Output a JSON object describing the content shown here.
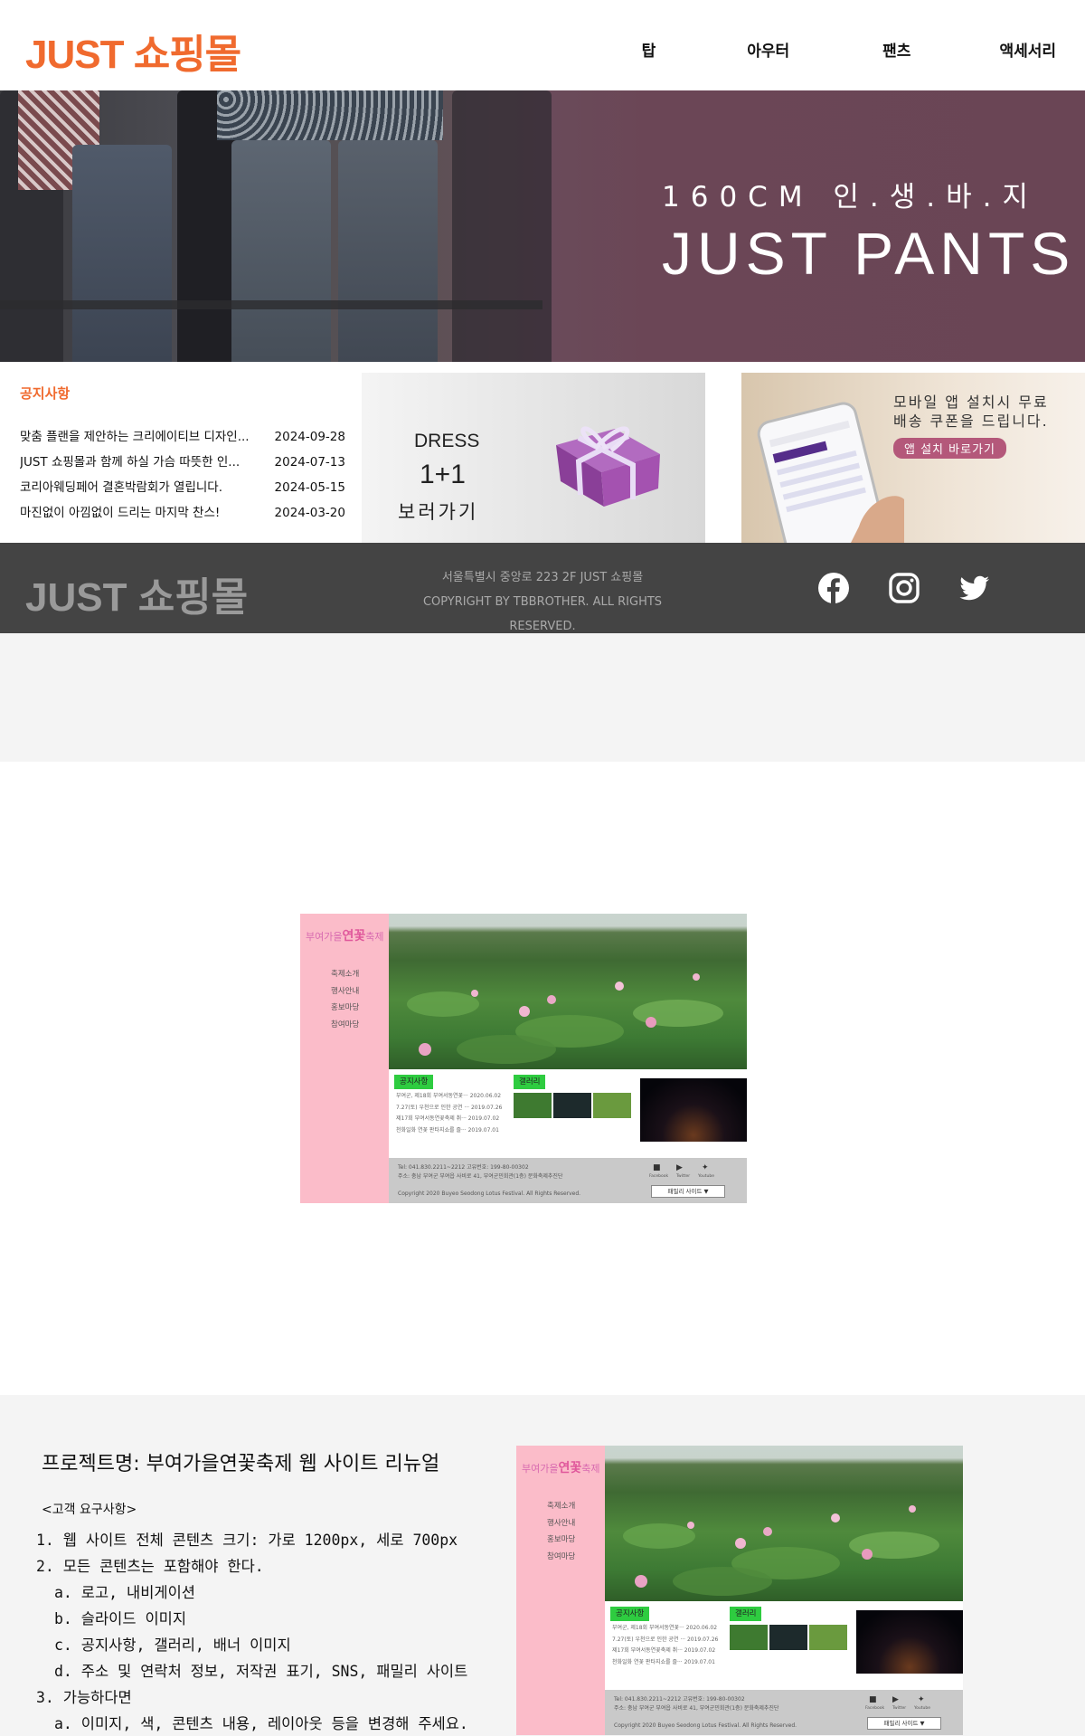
{
  "shop": {
    "logo": "JUST 쇼핑몰",
    "nav": [
      "탑",
      "아우터",
      "팬츠",
      "액세서리"
    ],
    "banner": {
      "subtitle": "160CM 인.생.바.지",
      "title": "JUST PANTS"
    },
    "notice": {
      "heading": "공지사항",
      "items": [
        {
          "title": "맞춤 플랜을 제안하는 크리에이티브 디자인...",
          "date": "2024-09-28"
        },
        {
          "title": "JUST 쇼핑몰과 함께 하실 가슴 따뜻한 인...",
          "date": "2024-07-13"
        },
        {
          "title": "코리아웨딩페어 결혼박람회가 열립니다.",
          "date": "2024-05-15"
        },
        {
          "title": "마진없이 아낌없이 드리는 마지막 찬스!",
          "date": "2024-03-20"
        }
      ]
    },
    "gift_banner": {
      "line1": "DRESS",
      "line2": "1+1",
      "line3": "보러가기"
    },
    "app_banner": {
      "line1": "모바일 앱 설치시 무료",
      "line2": "배송 쿠폰을 드립니다.",
      "button": "앱 설치 바로가기"
    },
    "footer": {
      "logo": "JUST 쇼핑몰",
      "address": "서울특별시 중앙로 223 2F JUST 쇼핑몰",
      "copyright": "COPYRIGHT BY TBBROTHER. ALL RIGHTS RESERVED.",
      "sns": [
        "facebook-icon",
        "instagram-icon",
        "twitter-icon"
      ]
    }
  },
  "thumbnail": {
    "logo_pre": "부여가을",
    "logo_main": "연꽃",
    "logo_post": "축제",
    "menu": [
      "축제소개",
      "행사안내",
      "홍보마당",
      "참여마당"
    ],
    "tab_notice": "공지사항",
    "tab_gallery": "갤러리",
    "notices": [
      "부여군, 제18회 부여서동연꽃··· 2020.06.02",
      "7.27(토) 우천으로 인한 공연 ··· 2019.07.26",
      "제17회 부여서동연꽃축제 취··· 2019.07.02",
      "천화일화 연꽃 판타지쇼를 즐··· 2019.07.01"
    ],
    "address": "Tel: 041.830.2211~2212 고유번호: 199-80-00302",
    "address2": "주소: 충남 부여군 부여읍 사비로 41, 부여군민회관(1층) 문화축제추진단",
    "copyright": "Copyright 2020 Buyeo Seodong Lotus Festival. All Rights Reserved.",
    "family_site": "패밀리 사이트 ▼",
    "sns_labels": [
      "Facebook",
      "Twitter",
      "Youtube"
    ]
  },
  "project": {
    "title": "프로젝트명: 부여가을연꽃축제 웹 사이트 리뉴얼",
    "req_heading": "<고객 요구사항>",
    "requirements": [
      "1. 웹 사이트 전체 콘텐츠 크기: 가로 1200px, 세로 700px",
      "2. 모든 콘텐츠는 포함해야 한다.",
      "a. 로고, 내비게이션",
      "b. 슬라이드 이미지",
      "c. 공지사항, 갤러리, 배너 이미지",
      "d. 주소 및 연락처 정보, 저작권 표기, SNS, 패밀리 사이트",
      "3. 가능하다면",
      "a. 이미지, 색, 콘텐츠 내용, 레이아웃 등을 변경해 주세요."
    ]
  }
}
